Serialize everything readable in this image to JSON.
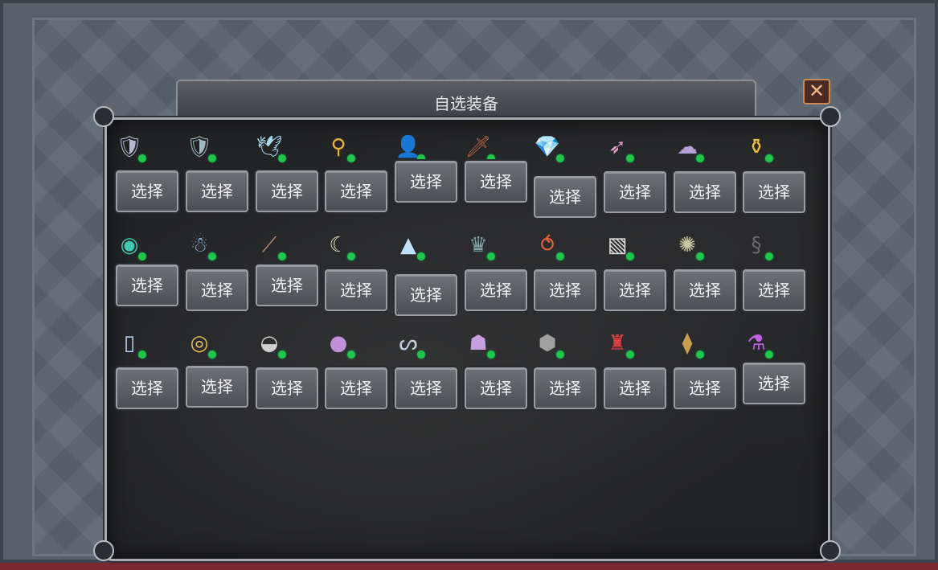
{
  "dialog": {
    "title": "自选装备",
    "close_label": "✕"
  },
  "rows": [
    [
      {
        "icon": "striped-shield-icon",
        "glyph": "🛡",
        "color": "#b9b9d2",
        "label": "选择"
      },
      {
        "icon": "steel-shield-icon",
        "glyph": "🛡",
        "color": "#9fb7c0",
        "label": "选择"
      },
      {
        "icon": "winged-shield-icon",
        "glyph": "🕊",
        "color": "#a8d8f0",
        "label": "选择"
      },
      {
        "icon": "golden-scepter-icon",
        "glyph": "⚲",
        "color": "#e8b340",
        "label": "选择"
      },
      {
        "icon": "brown-cloak-icon",
        "glyph": "👤",
        "color": "#7a5a4a",
        "label": "选择"
      },
      {
        "icon": "dagger-icon",
        "glyph": "🗡",
        "color": "#b06040",
        "label": "选择"
      },
      {
        "icon": "ruby-gem-icon",
        "glyph": "💎",
        "color": "#e85a3a",
        "label": "选择"
      },
      {
        "icon": "pink-arrow-icon",
        "glyph": "➶",
        "color": "#e8a0d0",
        "label": "选择"
      },
      {
        "icon": "purple-slime-icon",
        "glyph": "☁",
        "color": "#b8a0d8",
        "label": "选择"
      },
      {
        "icon": "golden-pot-icon",
        "glyph": "⚱",
        "color": "#e8c040",
        "label": "选择"
      }
    ],
    [
      {
        "icon": "rainbow-orb-icon",
        "glyph": "◉",
        "color": "#40c8b0",
        "label": "选择"
      },
      {
        "icon": "blue-creature-icon",
        "glyph": "☃",
        "color": "#90b8e8",
        "label": "选择"
      },
      {
        "icon": "fishing-rod-icon",
        "glyph": "⟋",
        "color": "#c09070",
        "label": "选择"
      },
      {
        "icon": "scythe-icon",
        "glyph": "☾",
        "color": "#e0e0c0",
        "label": "选择"
      },
      {
        "icon": "ice-crystal-icon",
        "glyph": "▲",
        "color": "#c0e0f8",
        "label": "选择"
      },
      {
        "icon": "crystal-crown-icon",
        "glyph": "♛",
        "color": "#80a8a8",
        "label": "选择"
      },
      {
        "icon": "amulet-necklace-icon",
        "glyph": "⥀",
        "color": "#e06040",
        "label": "选择"
      },
      {
        "icon": "red-card-icon",
        "glyph": "▧",
        "color": "#e0e0e0",
        "label": "选择"
      },
      {
        "icon": "dark-orb-icon",
        "glyph": "✺",
        "color": "#c8c8a0",
        "label": "选择"
      },
      {
        "icon": "dark-serpent-icon",
        "glyph": "§",
        "color": "#6a6a72",
        "label": "选择"
      }
    ],
    [
      {
        "icon": "test-tube-icon",
        "glyph": "▯",
        "color": "#b8d8ff",
        "label": "选择"
      },
      {
        "icon": "golden-ring-icon",
        "glyph": "◎",
        "color": "#e8c060",
        "label": "选择"
      },
      {
        "icon": "silver-shell-icon",
        "glyph": "◒",
        "color": "#d0d0d0",
        "label": "选择"
      },
      {
        "icon": "purple-drop-icon",
        "glyph": "●",
        "color": "#c090d8",
        "label": "选择"
      },
      {
        "icon": "spoon-icon",
        "glyph": "ᔕ",
        "color": "#c0d0e0",
        "label": "选择"
      },
      {
        "icon": "purple-mushroom-icon",
        "glyph": "☗",
        "color": "#c8a0e0",
        "label": "选择"
      },
      {
        "icon": "gray-stone-icon",
        "glyph": "⬢",
        "color": "#a0a0a0",
        "label": "选择"
      },
      {
        "icon": "red-armor-icon",
        "glyph": "♜",
        "color": "#d84040",
        "label": "选择"
      },
      {
        "icon": "golden-seed-icon",
        "glyph": "⧫",
        "color": "#c8a050",
        "label": "选择"
      },
      {
        "icon": "purple-potion-icon",
        "glyph": "⚗",
        "color": "#c060e0",
        "label": "选择"
      }
    ]
  ]
}
